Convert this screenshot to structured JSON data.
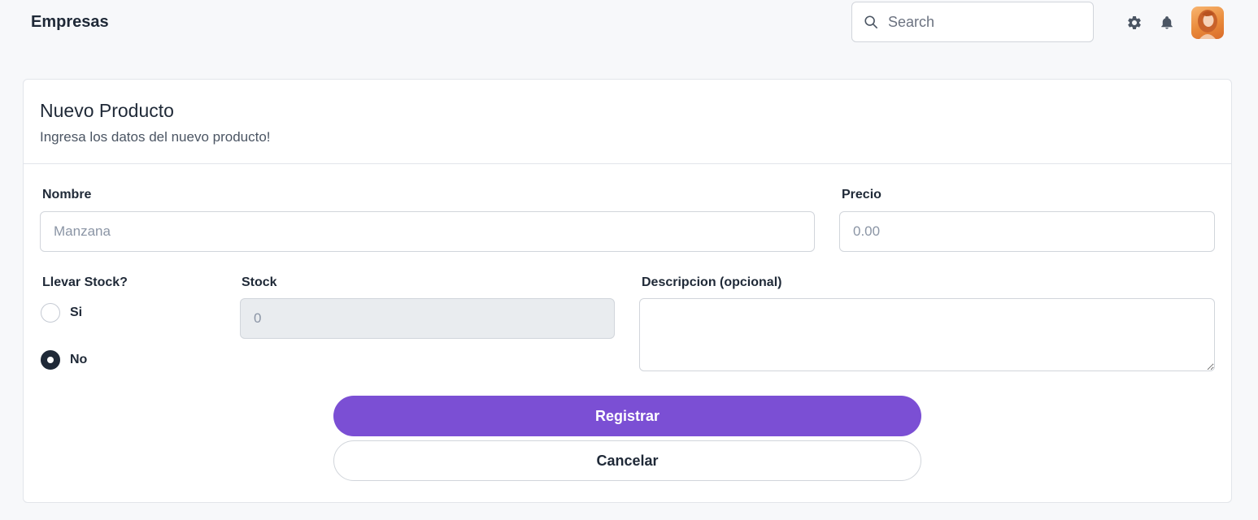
{
  "header": {
    "title": "Empresas",
    "search": {
      "placeholder": "Search",
      "value": ""
    },
    "icons": [
      "search-icon",
      "gear-icon",
      "bell-icon",
      "avatar"
    ]
  },
  "form": {
    "title": "Nuevo Producto",
    "subtitle": "Ingresa los datos del nuevo producto!",
    "nombre": {
      "label": "Nombre",
      "placeholder": "Manzana",
      "value": ""
    },
    "precio": {
      "label": "Precio",
      "placeholder": "0.00",
      "value": ""
    },
    "llevar_stock": {
      "label": "Llevar Stock?",
      "options": [
        {
          "label": "Si",
          "checked": false
        },
        {
          "label": "No",
          "checked": true
        }
      ]
    },
    "stock": {
      "label": "Stock",
      "placeholder": "0",
      "value": "",
      "disabled": true
    },
    "descripcion": {
      "label": "Descripcion (opcional)",
      "value": ""
    },
    "submit_label": "Registrar",
    "cancel_label": "Cancelar"
  },
  "colors": {
    "background": "#f7f8fa",
    "primary": "#7b4fd4",
    "text": "#1f2937",
    "muted": "#4b5563",
    "border": "#d1d5db",
    "disabled_bg": "#e9ecef"
  }
}
